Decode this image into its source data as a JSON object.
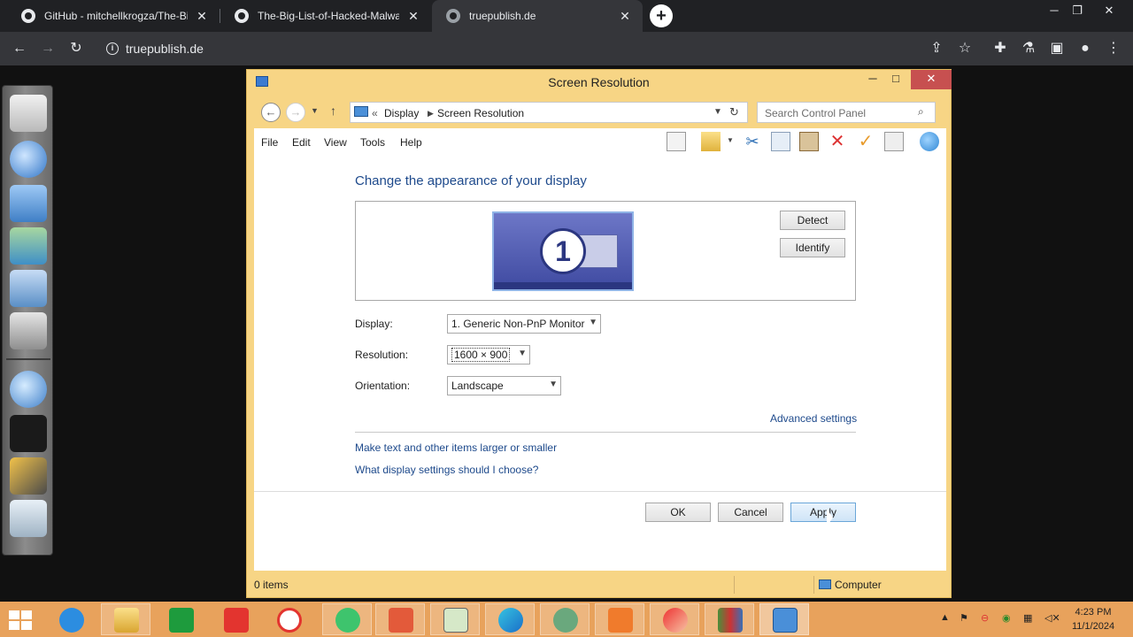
{
  "browser": {
    "tabs": [
      {
        "title": "GitHub - mitchellkrogza/The-Big",
        "active": false
      },
      {
        "title": "The-Big-List-of-Hacked-Malware",
        "active": false
      },
      {
        "title": "truepublish.de",
        "active": true
      }
    ],
    "url": "truepublish.de"
  },
  "window": {
    "title": "Screen Resolution",
    "breadcrumb": [
      "Display",
      "Screen Resolution"
    ],
    "breadcrumb_prefix": "«",
    "search_placeholder": "Search Control Panel",
    "menu": [
      "File",
      "Edit",
      "View",
      "Tools",
      "Help"
    ],
    "heading": "Change the appearance of your display",
    "monitor_number": "1",
    "detect_label": "Detect",
    "identify_label": "Identify",
    "display_label": "Display:",
    "display_value": "1. Generic Non-PnP Monitor",
    "resolution_label": "Resolution:",
    "resolution_value": "1600 × 900",
    "orientation_label": "Orientation:",
    "orientation_value": "Landscape",
    "advanced_link": "Advanced settings",
    "link_text_size": "Make text and other items larger or smaller",
    "link_help": "What display settings should I choose?",
    "ok_label": "OK",
    "cancel_label": "Cancel",
    "apply_label": "Apply",
    "status_items": "0 items",
    "status_location": "Computer"
  },
  "taskbar": {
    "time": "4:23 PM",
    "date": "11/1/2024",
    "accent": "#e8a25c"
  }
}
